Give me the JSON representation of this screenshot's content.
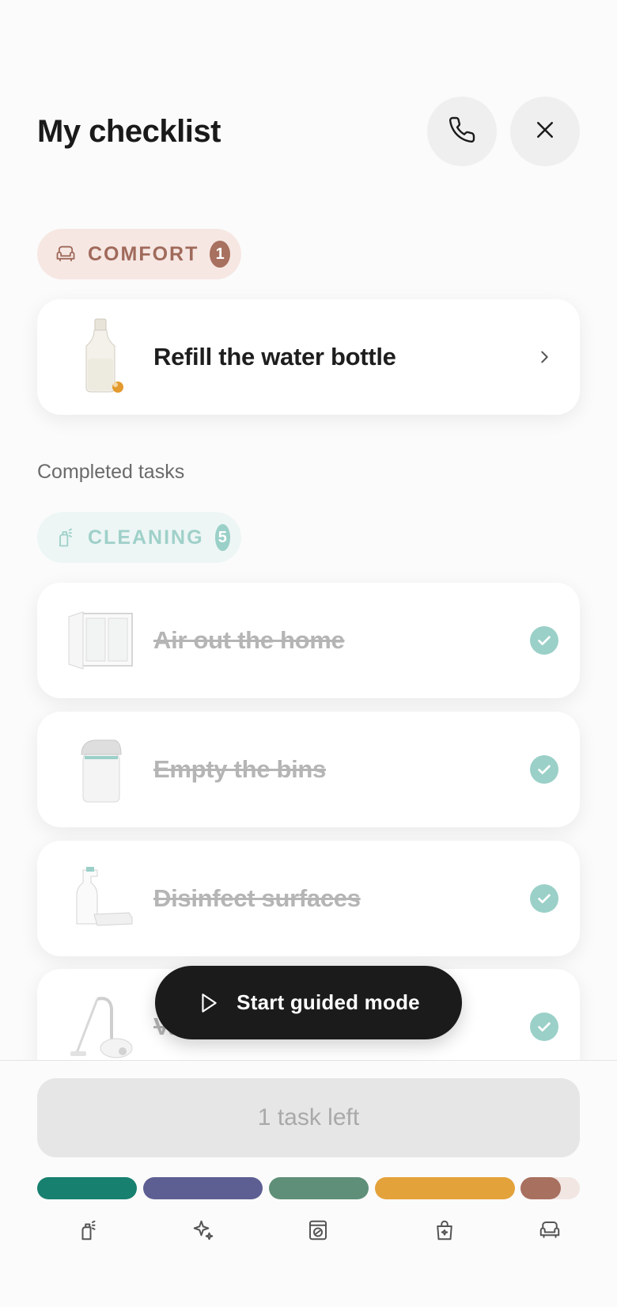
{
  "header": {
    "title": "My checklist",
    "phone_icon": "phone-icon",
    "close_icon": "close-icon"
  },
  "comfort_category": {
    "label": "COMFORT",
    "count": "1",
    "icon": "armchair-icon"
  },
  "pending_tasks": [
    {
      "label": "Refill the water bottle",
      "image": "water-bottle-image",
      "icon": "chevron-right-icon"
    }
  ],
  "completed": {
    "title": "Completed tasks",
    "category": {
      "label": "CLEANING",
      "count": "5",
      "icon": "spray-bottle-icon"
    },
    "tasks": [
      {
        "label": "Air out the home",
        "image": "window-image"
      },
      {
        "label": "Empty the bins",
        "image": "trash-bin-image"
      },
      {
        "label": "Disinfect surfaces",
        "image": "spray-and-cloth-image"
      },
      {
        "label": "Va",
        "image": "vacuum-cleaner-image"
      }
    ]
  },
  "guided_mode": {
    "label": "Start guided mode",
    "icon": "play-icon"
  },
  "footer": {
    "tasks_left": "1 task left",
    "progress_colors": [
      "#17806f",
      "#5d5f93",
      "#5f8f78",
      "#e4a23b",
      "#a8705f"
    ],
    "nav_icons": [
      "spray-bottle-icon",
      "sparkles-icon",
      "washing-machine-icon",
      "shopping-bag-icon",
      "armchair-icon"
    ]
  }
}
